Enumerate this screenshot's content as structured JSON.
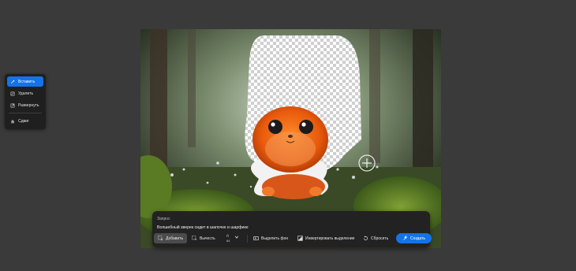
{
  "tools": {
    "items": [
      {
        "label": "Вставить",
        "icon": "insert-brush-icon",
        "active": true
      },
      {
        "label": "Удалить",
        "icon": "remove-brush-icon",
        "active": false
      },
      {
        "label": "Развернуть",
        "icon": "expand-icon",
        "active": false
      },
      {
        "label": "Сдвиг",
        "icon": "hand-icon",
        "active": false
      }
    ]
  },
  "prompt": {
    "label": "Запрос",
    "text": "Волшебный зверек сидит в шапочке и шарфике"
  },
  "actions": {
    "add": "Добавить",
    "subtract": "Вычесть",
    "stepper_label": "Д",
    "stepper_value": "64",
    "select_background": "Выделить фон",
    "invert_selection": "Инвертировать выделение",
    "reset": "Сбросить",
    "generate": "Создать"
  },
  "colors": {
    "accent": "#1473e6",
    "background": "#3a3a3a",
    "panel": "#1f1f1f"
  }
}
